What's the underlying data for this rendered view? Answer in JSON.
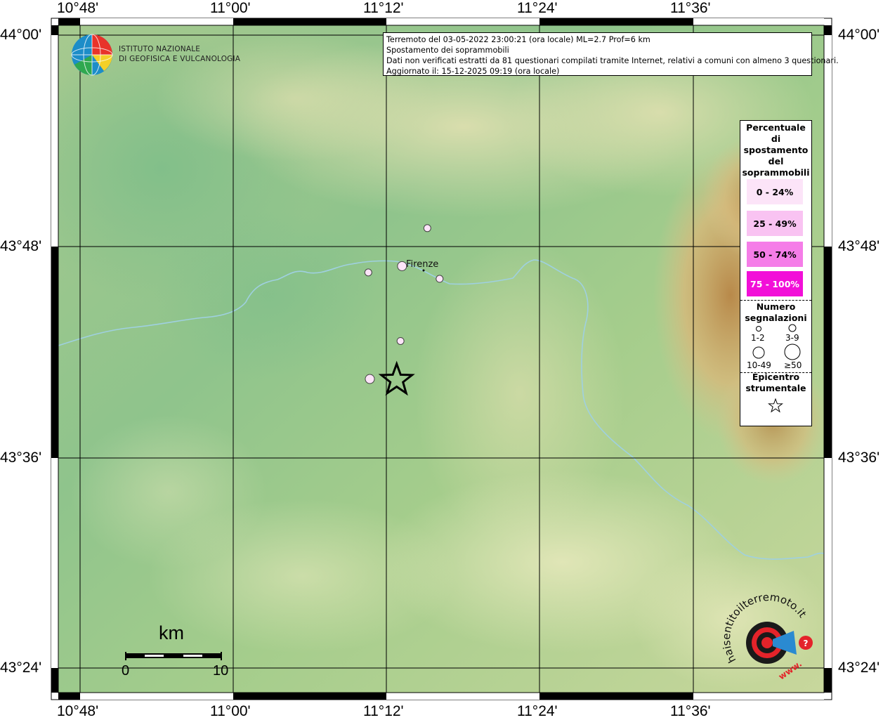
{
  "header": {
    "line1": "Terremoto del 03-05-2022 23:00:21 (ora locale) ML=2.7 Prof=6 km",
    "line2": "Spostamento dei soprammobili",
    "line3": "Dati non verificati estratti da 81 questionari compilati tramite Internet, relativi a comuni con almeno 3 questionari.",
    "line4": "Aggiornato il: 15-12-2025 09:19 (ora locale)"
  },
  "logo": {
    "line1": "ISTITUTO NAZIONALE",
    "line2": "DI GEOFISICA E VULCANOLOGIA"
  },
  "axes": {
    "lon_top": [
      "10°48'",
      "11°00'",
      "11°12'",
      "11°24'",
      "11°36'"
    ],
    "lon_bottom": [
      "10°48'",
      "11°00'",
      "11°12'",
      "11°24'",
      "11°36'"
    ],
    "lat_left": [
      "44°00'",
      "43°48'",
      "43°36'",
      "43°24'"
    ],
    "lat_right": [
      "44°00'",
      "43°48'",
      "43°36'",
      "43°24'"
    ]
  },
  "map": {
    "city": "Firenze",
    "scale_unit": "km",
    "scale_start": "0",
    "scale_end": "10",
    "observations": [
      {
        "lon": 11.253,
        "lat": 43.817,
        "pct_class": "0 - 24%",
        "count_class": "1-2"
      },
      {
        "lon": 11.22,
        "lat": 43.781,
        "pct_class": "0 - 24%",
        "count_class": "3-9"
      },
      {
        "lon": 11.176,
        "lat": 43.775,
        "pct_class": "0 - 24%",
        "count_class": "1-2"
      },
      {
        "lon": 11.269,
        "lat": 43.769,
        "pct_class": "0 - 24%",
        "count_class": "1-2"
      },
      {
        "lon": 11.218,
        "lat": 43.71,
        "pct_class": "0 - 24%",
        "count_class": "1-2"
      },
      {
        "lon": 11.178,
        "lat": 43.674,
        "pct_class": "0 - 24%",
        "count_class": "3-9"
      }
    ],
    "epicenter": {
      "lon": 11.213,
      "lat": 43.673
    }
  },
  "legend": {
    "title_lines": [
      "Percentuale",
      "di",
      "spostamento",
      "del",
      "soprammobili"
    ],
    "classes": [
      {
        "label": "0 - 24%",
        "color": "#fce4f8"
      },
      {
        "label": "25 - 49%",
        "color": "#f9c3f2"
      },
      {
        "label": "50 - 74%",
        "color": "#f57de8"
      },
      {
        "label": "75 - 100%",
        "color": "#f20fd8"
      }
    ],
    "count_title_lines": [
      "Numero",
      "segnalazioni"
    ],
    "count_labels": [
      "1-2",
      "3-9",
      "10-49",
      "≥50"
    ],
    "epicenter_title_lines": [
      "Epicentro",
      "strumentale"
    ]
  },
  "watermark": {
    "text": "haisentitoilterremoto.it",
    "url": "www."
  },
  "colors": {
    "grid": "#000000",
    "river": "#9fd0e0",
    "point_fill": "#fce4f8"
  }
}
